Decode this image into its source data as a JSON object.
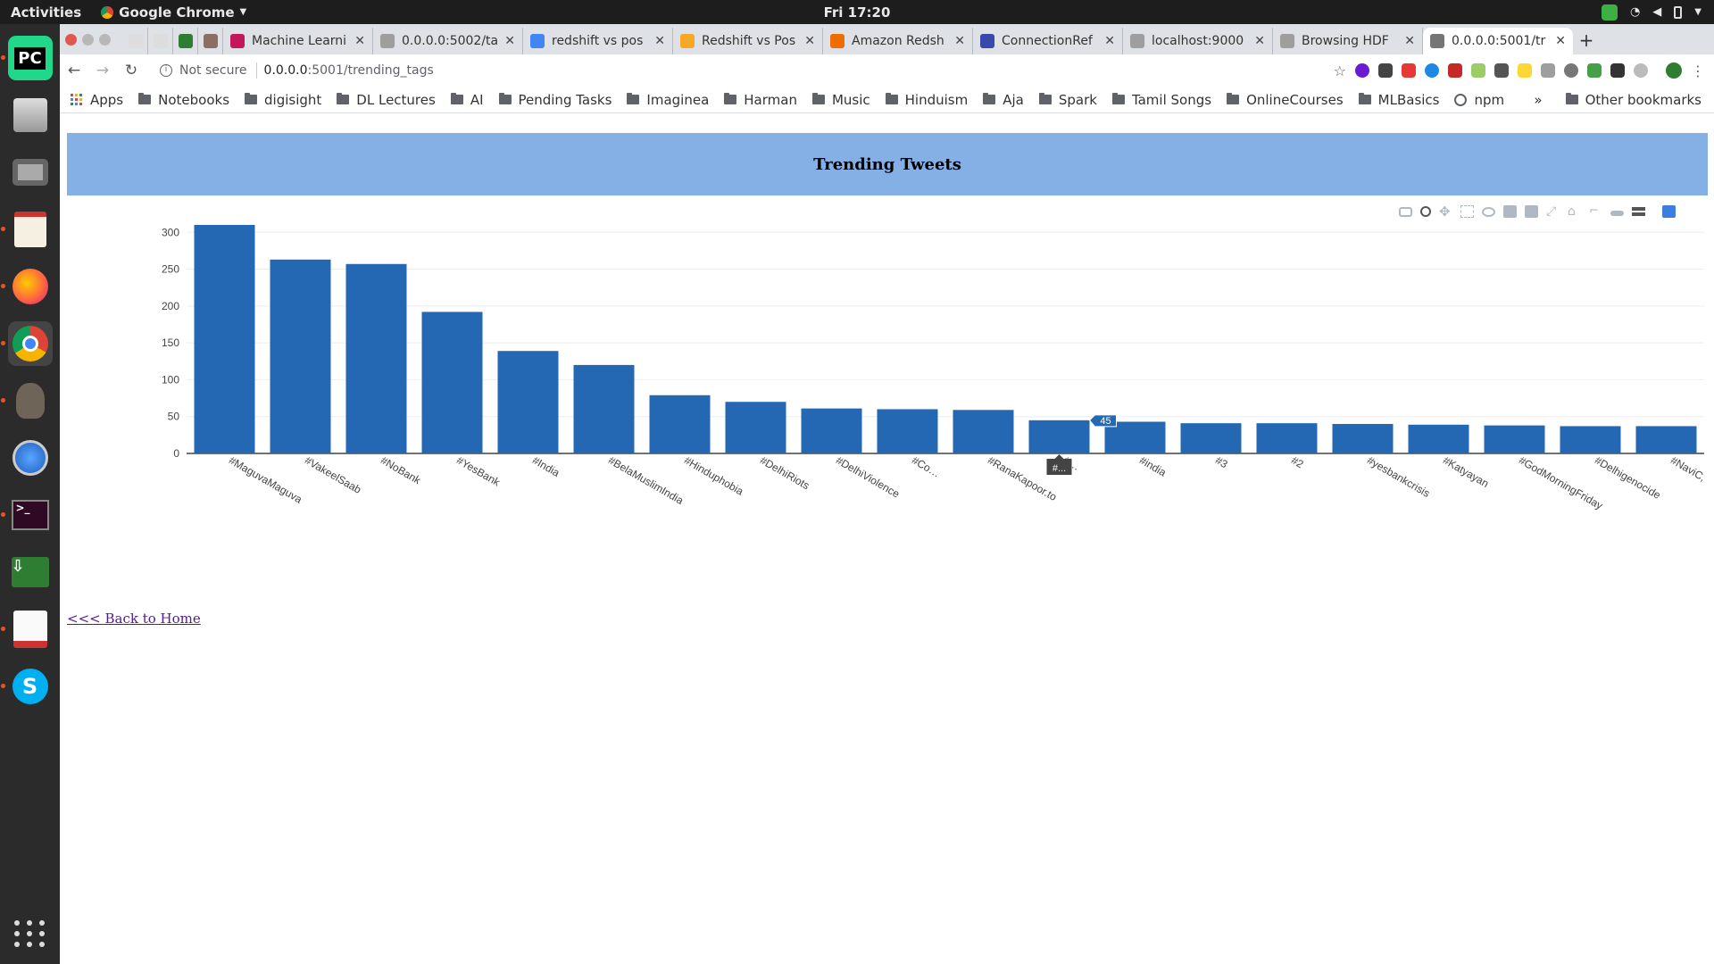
{
  "system": {
    "activities": "Activities",
    "app_name": "Google Chrome",
    "clock": "Fri 17:20"
  },
  "browser": {
    "tabs": [
      {
        "title": "",
        "kind": "small"
      },
      {
        "title": "",
        "kind": "small"
      },
      {
        "title": "",
        "kind": "small"
      },
      {
        "title": "",
        "kind": "small"
      },
      {
        "title": "Machine Learni",
        "kind": "wide"
      },
      {
        "title": "0.0.0.0:5002/ta",
        "kind": "wide"
      },
      {
        "title": "redshift vs pos",
        "kind": "wide"
      },
      {
        "title": "Redshift vs Pos",
        "kind": "wide"
      },
      {
        "title": "Amazon Redsh",
        "kind": "wide"
      },
      {
        "title": "ConnectionRef",
        "kind": "wide"
      },
      {
        "title": "localhost:9000",
        "kind": "wide"
      },
      {
        "title": "Browsing HDF",
        "kind": "wide"
      },
      {
        "title": "0.0.0.0:5001/tr",
        "kind": "wide",
        "active": true
      }
    ],
    "security_label": "Not secure",
    "url_host": "0.0.0.0",
    "url_rest": ":5001/trending_tags",
    "bookmarks": [
      "Apps",
      "Notebooks",
      "digisight",
      "DL Lectures",
      "AI",
      "Pending Tasks",
      "Imaginea",
      "Harman",
      "Music",
      "Hinduism",
      "Aja",
      "Spark",
      "Tamil Songs",
      "OnlineCourses",
      "MLBasics",
      "npm"
    ],
    "more_bookmarks": "»",
    "other_bookmarks": "Other bookmarks"
  },
  "page": {
    "heading": "Trending Tweets",
    "back_link": "<<< Back to Home"
  },
  "chart_data": {
    "type": "bar",
    "categories": [
      "#MaguvaMaguva",
      "#VakeelSaab",
      "#NoBank",
      "#YesBank",
      "#India",
      "#BelaMuslimIndia",
      "#Hinduphobia",
      "#DelhiRiots",
      "#DelhiViolence",
      "#Co…",
      "#RanaKapoor.to",
      "#…",
      "#india",
      "#3",
      "#2",
      "#yesbankcrisis",
      "#Katyayan",
      "#GodMorningFriday",
      "#Delhigenocide",
      "#NaviC,"
    ],
    "values": [
      310,
      263,
      257,
      192,
      139,
      120,
      79,
      70,
      61,
      60,
      59,
      45,
      43,
      41,
      41,
      40,
      39,
      38,
      37,
      37
    ],
    "ylim": [
      0,
      310
    ],
    "yticks": [
      0,
      50,
      100,
      150,
      200,
      250,
      300
    ],
    "bar_color": "#2468b4",
    "hover": {
      "index": 11,
      "value_label": "45",
      "category_label": "#..."
    },
    "grid": true
  }
}
